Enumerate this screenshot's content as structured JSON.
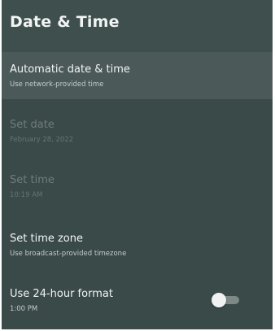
{
  "header": {
    "title": "Date & Time"
  },
  "items": [
    {
      "label": "Automatic date & time",
      "sub": "Use network-provided time",
      "state": "focused"
    },
    {
      "label": "Set date",
      "sub": "February 28, 2022",
      "state": "disabled"
    },
    {
      "label": "Set time",
      "sub": "10:19 AM",
      "state": "disabled"
    },
    {
      "label": "Set time zone",
      "sub": "Use broadcast-provided timezone",
      "state": "enabled"
    },
    {
      "label": "Use 24-hour format",
      "sub": "1:00 PM",
      "state": "enabled",
      "toggle": "off"
    }
  ],
  "colors": {
    "background": "#3a4a49",
    "header": "#3e4f4e",
    "focused_row": "#4b5a59",
    "text": "#f2f4f3",
    "disabled_text": "#6f7d7c"
  }
}
